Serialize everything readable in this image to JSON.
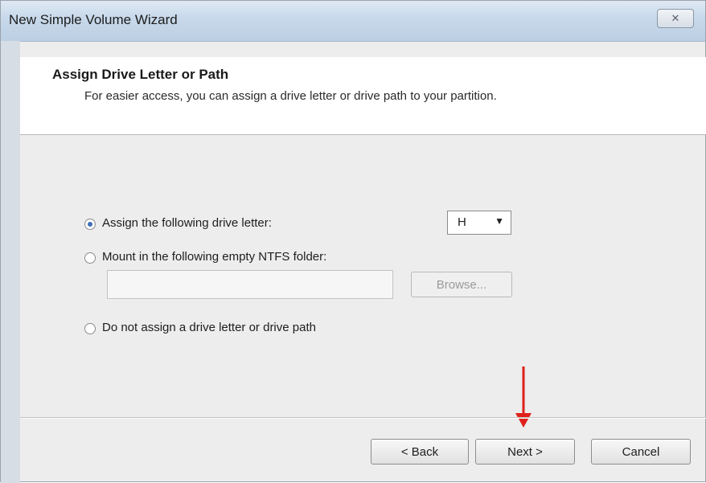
{
  "window": {
    "title": "New Simple Volume Wizard",
    "close_glyph": "✕"
  },
  "header": {
    "title": "Assign Drive Letter or Path",
    "subtitle": "For easier access, you can assign a drive letter or drive path to your partition."
  },
  "options": {
    "assign_letter": {
      "label": "Assign the following drive letter:",
      "checked": true
    },
    "mount_folder": {
      "label": "Mount in the following empty NTFS folder:",
      "checked": false
    },
    "no_assign": {
      "label": "Do not assign a drive letter or drive path",
      "checked": false
    }
  },
  "drive_letter_select": {
    "value": "H",
    "caret": "▼"
  },
  "folder_path_input": {
    "value": ""
  },
  "buttons": {
    "browse": "Browse...",
    "back": "< Back",
    "next": "Next >",
    "cancel": "Cancel"
  },
  "annotation": {
    "arrow_color": "#e0201b"
  }
}
